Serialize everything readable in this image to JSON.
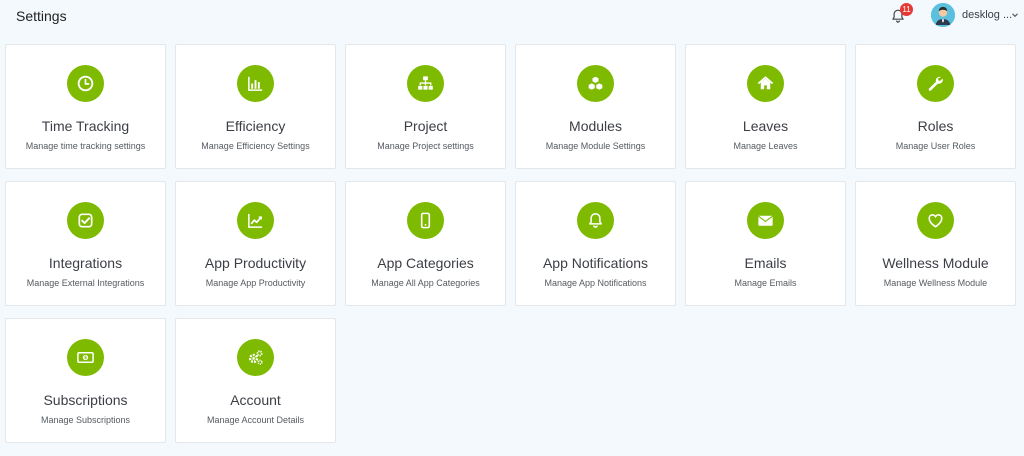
{
  "header": {
    "title": "Settings",
    "notification_count": "11",
    "user_name": "desklog ..."
  },
  "colors": {
    "accent": "#7dba00",
    "badge": "#e53935",
    "background": "#f4f9fd"
  },
  "cards": [
    {
      "title": "Time Tracking",
      "description": "Manage time tracking settings",
      "icon": "clock-icon"
    },
    {
      "title": "Efficiency",
      "description": "Manage Efficiency Settings",
      "icon": "bar-chart-icon"
    },
    {
      "title": "Project",
      "description": "Manage Project settings",
      "icon": "sitemap-icon"
    },
    {
      "title": "Modules",
      "description": "Manage Module Settings",
      "icon": "cubes-icon"
    },
    {
      "title": "Leaves",
      "description": "Manage Leaves",
      "icon": "home-icon"
    },
    {
      "title": "Roles",
      "description": "Manage User Roles",
      "icon": "wrench-icon"
    },
    {
      "title": "Integrations",
      "description": "Manage External Integrations",
      "icon": "check-square-icon"
    },
    {
      "title": "App Productivity",
      "description": "Manage App Productivity",
      "icon": "line-chart-icon"
    },
    {
      "title": "App Categories",
      "description": "Manage All App Categories",
      "icon": "mobile-icon"
    },
    {
      "title": "App Notifications",
      "description": "Manage App Notifications",
      "icon": "bell-icon"
    },
    {
      "title": "Emails",
      "description": "Manage Emails",
      "icon": "envelope-icon"
    },
    {
      "title": "Wellness Module",
      "description": "Manage Wellness Module",
      "icon": "heart-icon"
    },
    {
      "title": "Subscriptions",
      "description": "Manage Subscriptions",
      "icon": "money-icon"
    },
    {
      "title": "Account",
      "description": "Manage Account Details",
      "icon": "cogs-icon"
    }
  ]
}
